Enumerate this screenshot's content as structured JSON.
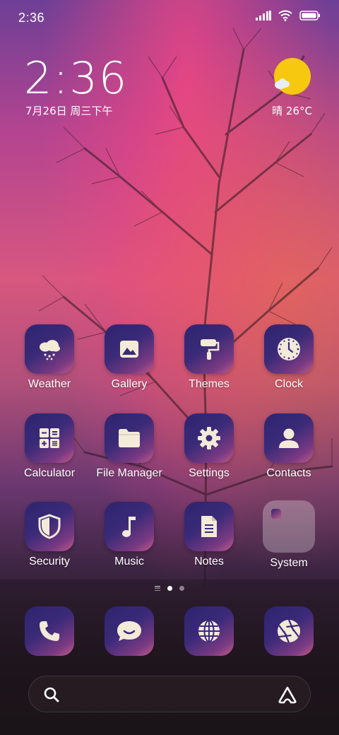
{
  "status_bar": {
    "time": "2:36",
    "icons": [
      "signal-icon",
      "wifi-icon",
      "battery-icon"
    ]
  },
  "clock_widget": {
    "time": "2:36",
    "date": "7月26日 周三下午"
  },
  "weather_widget": {
    "condition_icon": "sun-cloud-icon",
    "text": "晴 26°C"
  },
  "apps": [
    {
      "label": "Weather",
      "icon": "weather-icon"
    },
    {
      "label": "Gallery",
      "icon": "gallery-icon"
    },
    {
      "label": "Themes",
      "icon": "themes-icon"
    },
    {
      "label": "Clock",
      "icon": "clock-icon"
    },
    {
      "label": "Calculator",
      "icon": "calculator-icon"
    },
    {
      "label": "File Manager",
      "icon": "folder-icon"
    },
    {
      "label": "Settings",
      "icon": "gear-icon"
    },
    {
      "label": "Contacts",
      "icon": "contact-icon"
    },
    {
      "label": "Security",
      "icon": "shield-icon"
    },
    {
      "label": "Music",
      "icon": "music-note-icon"
    },
    {
      "label": "Notes",
      "icon": "note-icon"
    },
    {
      "label": "System",
      "icon": "folder-group-icon"
    }
  ],
  "page_indicator": {
    "pages": 2,
    "current": 1
  },
  "dock": [
    {
      "icon": "phone-icon"
    },
    {
      "icon": "message-icon"
    },
    {
      "icon": "globe-icon"
    },
    {
      "icon": "camera-aperture-icon"
    }
  ],
  "search": {
    "placeholder": "",
    "icon": "search-icon",
    "assistant_icon": "assistant-icon"
  },
  "colors": {
    "sun": "#f6c80f",
    "icon_tile_dark": "#2e2470",
    "icon_tile_pink": "#c45b8a",
    "icon_glyph": "#f3ead8"
  }
}
